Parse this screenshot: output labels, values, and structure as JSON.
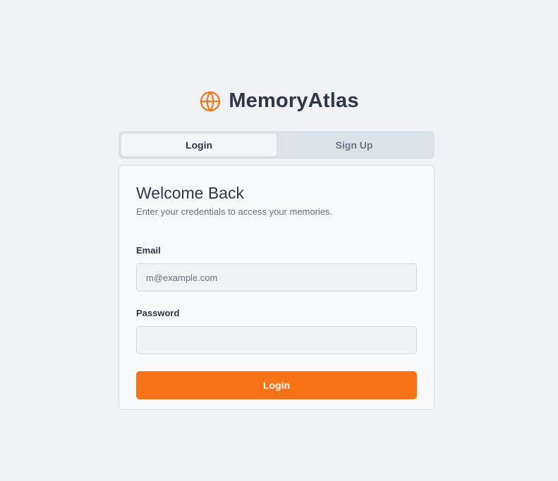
{
  "brand": {
    "name": "MemoryAtlas",
    "icon": "globe-icon",
    "accent_color": "#f97316"
  },
  "tabs": [
    {
      "label": "Login",
      "active": true
    },
    {
      "label": "Sign Up",
      "active": false
    }
  ],
  "card": {
    "title": "Welcome Back",
    "subtitle": "Enter your credentials to access your memories."
  },
  "form": {
    "email_label": "Email",
    "email_placeholder": "m@example.com",
    "email_value": "",
    "password_label": "Password",
    "password_placeholder": "",
    "password_value": "",
    "submit_label": "Login"
  }
}
